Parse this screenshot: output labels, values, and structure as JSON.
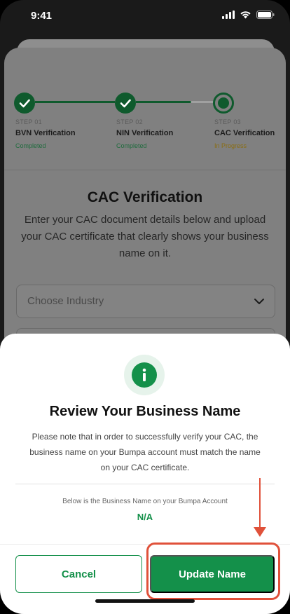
{
  "status_bar": {
    "time": "9:41"
  },
  "stepper": {
    "steps": [
      {
        "num": "STEP 01",
        "name": "BVN Verification",
        "status": "Completed"
      },
      {
        "num": "STEP 02",
        "name": "NIN Verification",
        "status": "Completed"
      },
      {
        "num": "STEP 03",
        "name": "CAC Verification",
        "status": "In Progress"
      }
    ]
  },
  "background_page": {
    "title": "CAC Verification",
    "description": "Enter your CAC document details below and upload your CAC certificate that clearly shows your business name on it.",
    "industry_placeholder": "Choose Industry"
  },
  "modal": {
    "title": "Review Your Business Name",
    "description": "Please note that in order to successfully verify your CAC, the business name on your Bumpa account must match the name on your CAC certificate.",
    "business_name_label": "Below is the Business Name on your Bumpa Account",
    "business_name_value": "N/A",
    "cancel_label": "Cancel",
    "update_label": "Update Name"
  },
  "colors": {
    "accent": "#14904a",
    "completed": "#14904a",
    "in_progress": "#c9a227",
    "annotation": "#e0513a"
  },
  "icons": [
    "signal-icon",
    "wifi-icon",
    "battery-icon",
    "check-icon",
    "chevron-down-icon",
    "info-icon"
  ]
}
